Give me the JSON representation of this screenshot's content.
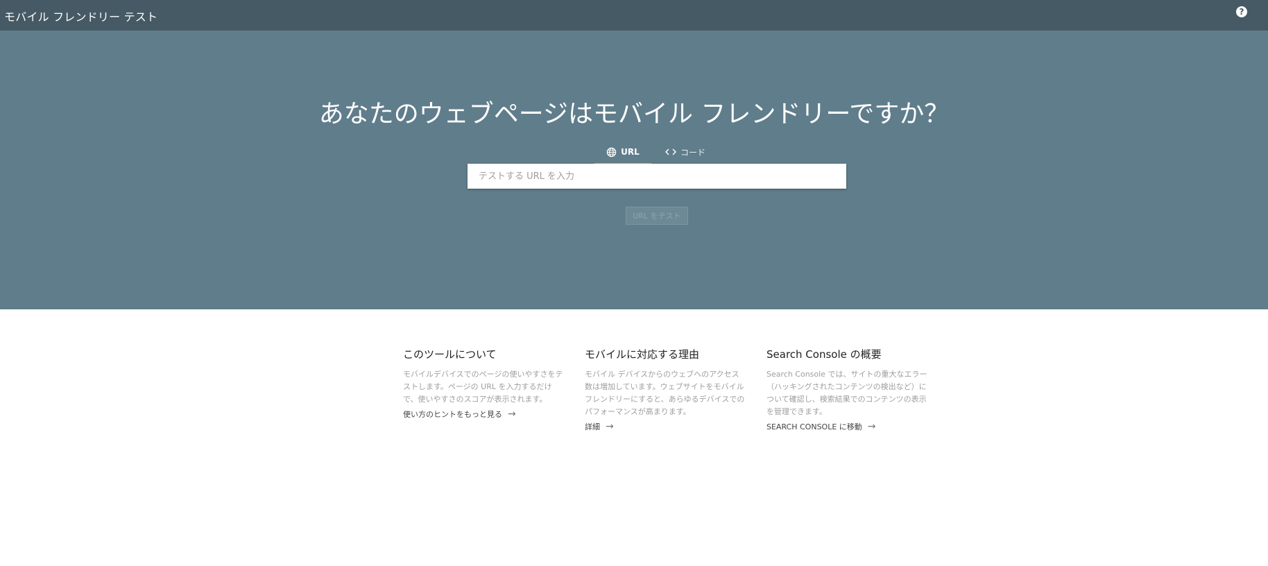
{
  "header": {
    "title": "モバイル フレンドリー テスト",
    "help_icon": "help-icon"
  },
  "hero": {
    "title": "あなたのウェブページはモバイル フレンドリーですか？",
    "tabs": [
      {
        "label": "URL",
        "icon": "globe-icon",
        "selected": true
      },
      {
        "label": "コード",
        "icon": "code-icon",
        "selected": false
      }
    ],
    "url_input": {
      "placeholder": "テストする URL を入力",
      "value": ""
    },
    "test_button_label": "URL をテスト"
  },
  "info": [
    {
      "title": "このツールについて",
      "text": "モバイルデバイスでのページの使いやすさをテストします。ページの URL を入力するだけで、使いやすさのスコアが表示されます。",
      "link": "使い方のヒントをもっと見る"
    },
    {
      "title": "モバイルに対応する理由",
      "text": "モバイル デバイスからのウェブへのアクセス数は増加しています。ウェブサイトをモバイル フレンドリーにすると、あらゆるデバイスでのパフォーマンスが高まります。",
      "link": "詳細"
    },
    {
      "title": "Search Console の概要",
      "text": "Search Console では、サイトの重大なエラー（ハッキングされたコンテンツの検出など）について確認し、検索結果でのコンテンツの表示を管理できます。",
      "link": "SEARCH CONSOLE に移動"
    }
  ],
  "colors": {
    "topbar": "#455a64",
    "hero": "#607d8b",
    "tab_indicator": "#f4a300"
  }
}
